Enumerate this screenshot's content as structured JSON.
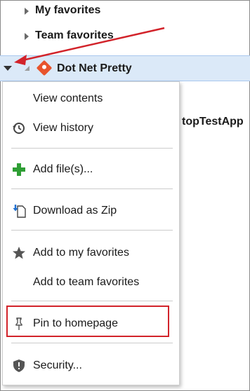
{
  "tree": {
    "my_favorites": "My favorites",
    "team_favorites": "Team favorites",
    "repo_name": "Dot Net Pretty",
    "partial_item": "topTestApp"
  },
  "menu": {
    "view_contents": "View contents",
    "view_history": "View history",
    "add_files": "Add file(s)...",
    "download_zip": "Download as Zip",
    "add_my_favorites": "Add to my favorites",
    "add_team_favorites": "Add to team favorites",
    "pin_homepage": "Pin to homepage",
    "security": "Security..."
  },
  "colors": {
    "selection": "#dbe9f8",
    "git_orange": "#e8542d",
    "add_green": "#2e9e34",
    "callout_red": "#d2232a"
  },
  "icons": {
    "history": "history-icon",
    "add": "plus-icon",
    "download": "download-zip-icon",
    "favorite": "star-icon",
    "pin": "pin-icon",
    "security": "shield-icon",
    "git": "git-repo-icon"
  }
}
